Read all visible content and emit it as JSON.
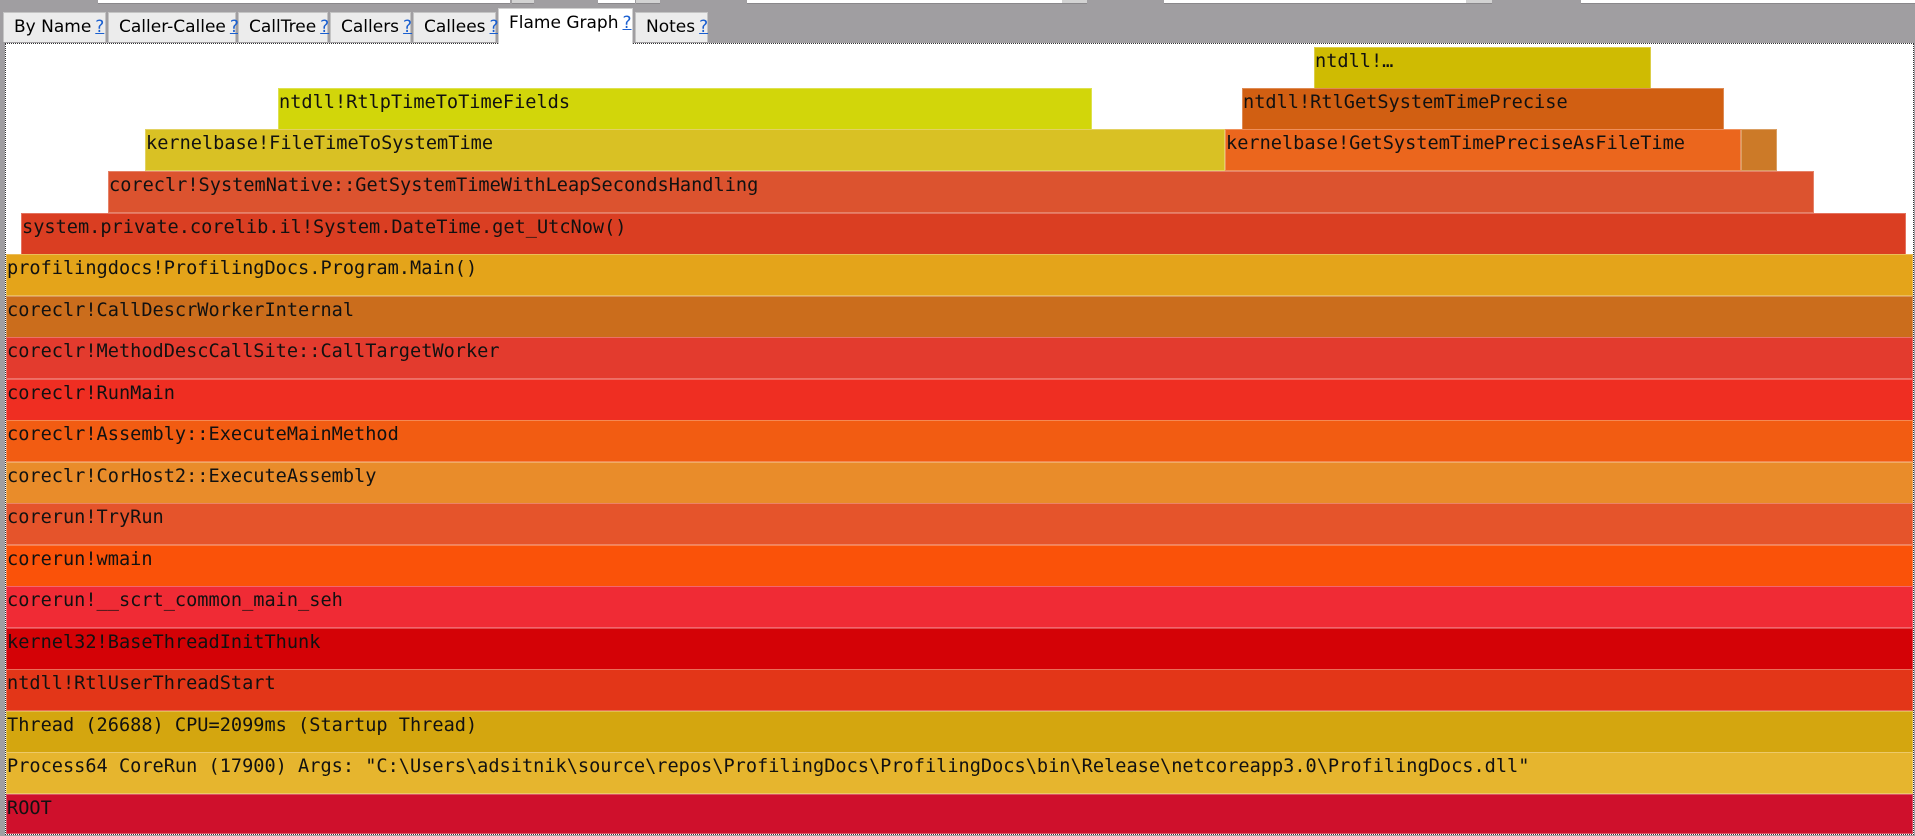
{
  "tabs": [
    {
      "label": "By Name",
      "help": "?"
    },
    {
      "label": "Caller-Callee",
      "help": "?"
    },
    {
      "label": "CallTree",
      "help": "?"
    },
    {
      "label": "Callers",
      "help": "?"
    },
    {
      "label": "Callees",
      "help": "?"
    },
    {
      "label": "Flame Graph",
      "help": "?",
      "active": true
    },
    {
      "label": "Notes",
      "help": "?"
    }
  ],
  "flame_graph": {
    "frames": [
      {
        "name": "ntdll!…",
        "color": "#CFBB02"
      },
      {
        "name": "ntdll!RtlpTimeToTimeFields",
        "color": "#D2D60A"
      },
      {
        "name": "ntdll!RtlGetSystemTimePrecise",
        "color": "#D15F12"
      },
      {
        "name": "kernelbase!FileTimeToSystemTime",
        "color": "#D9C124"
      },
      {
        "name": "kernelbase!GetSystemTimePreciseAsFileTime",
        "color": "#EB661D"
      },
      {
        "name": "",
        "color": "#CC7A28"
      },
      {
        "name": "coreclr!SystemNative::GetSystemTimeWithLeapSecondsHandling",
        "color": "#DC532F"
      },
      {
        "name": "system.private.corelib.il!System.DateTime.get_UtcNow()",
        "color": "#DA3E22"
      },
      {
        "name": "profilingdocs!ProfilingDocs.Program.Main()",
        "color": "#E4A41A"
      },
      {
        "name": "coreclr!CallDescrWorkerInternal",
        "color": "#CB6D1C"
      },
      {
        "name": "coreclr!MethodDescCallSite::CallTargetWorker",
        "color": "#E33B2E"
      },
      {
        "name": "coreclr!RunMain",
        "color": "#EF2E22"
      },
      {
        "name": "coreclr!Assembly::ExecuteMainMethod",
        "color": "#F25C12"
      },
      {
        "name": "coreclr!CorHost2::ExecuteAssembly",
        "color": "#E98C2A"
      },
      {
        "name": "corerun!TryRun",
        "color": "#E5542B"
      },
      {
        "name": "corerun!wmain",
        "color": "#FA5209"
      },
      {
        "name": "corerun!__scrt_common_main_seh",
        "color": "#F02B35"
      },
      {
        "name": "kernel32!BaseThreadInitThunk",
        "color": "#D40206"
      },
      {
        "name": "ntdll!RtlUserThreadStart",
        "color": "#E33618"
      },
      {
        "name": "Thread (26688) CPU=2099ms (Startup Thread)",
        "color": "#D4A60F"
      },
      {
        "name": "Process64 CoreRun (17900) Args:  \"C:\\Users\\adsitnik\\source\\repos\\ProfilingDocs\\ProfilingDocs\\bin\\Release\\netcoreapp3.0\\ProfilingDocs.dll\"",
        "color": "#E6B52E"
      },
      {
        "name": "ROOT",
        "color": "#CF102C"
      }
    ]
  }
}
